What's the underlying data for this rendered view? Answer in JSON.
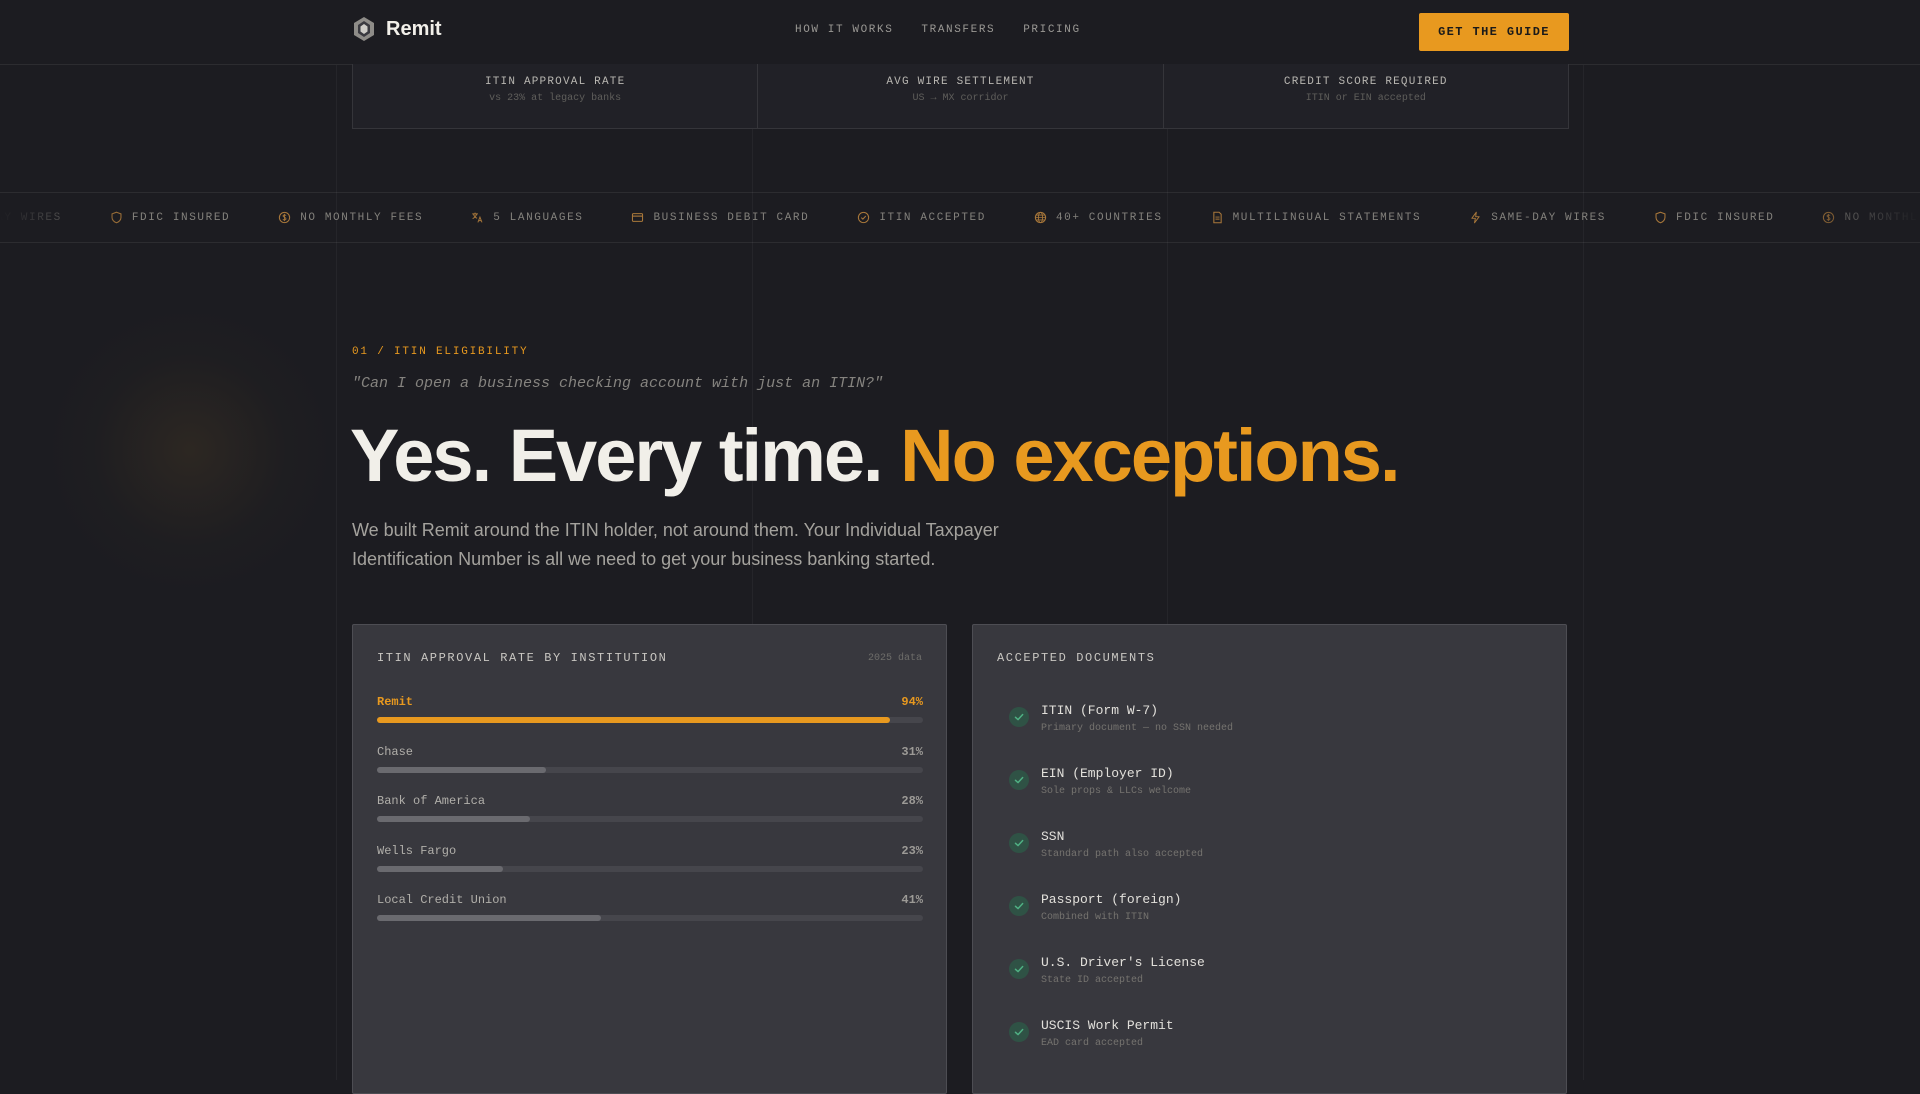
{
  "nav": {
    "brand": "Remit",
    "links": [
      "HOW IT WORKS",
      "TRANSFERS",
      "PRICING"
    ],
    "cta": "GET THE GUIDE"
  },
  "stats": [
    {
      "label": "ITIN APPROVAL RATE",
      "sub": "vs 23% at legacy banks"
    },
    {
      "label": "AVG WIRE SETTLEMENT",
      "sub": "US → MX corridor"
    },
    {
      "label": "CREDIT SCORE REQUIRED",
      "sub": "ITIN or EIN accepted"
    }
  ],
  "marquee": [
    {
      "label": "DAY WIRES",
      "icon": "bolt-icon"
    },
    {
      "label": "FDIC INSURED",
      "icon": "shield-icon"
    },
    {
      "label": "NO MONTHLY FEES",
      "icon": "dollar-circle-icon"
    },
    {
      "label": "5 LANGUAGES",
      "icon": "translate-icon"
    },
    {
      "label": "BUSINESS DEBIT CARD",
      "icon": "card-icon"
    },
    {
      "label": "ITIN ACCEPTED",
      "icon": "check-circle-icon"
    },
    {
      "label": "40+ COUNTRIES",
      "icon": "globe-icon"
    },
    {
      "label": "MULTILINGUAL STATEMENTS",
      "icon": "document-icon"
    },
    {
      "label": "SAME-DAY WIRES",
      "icon": "bolt-icon"
    },
    {
      "label": "FDIC INSURED",
      "icon": "shield-icon"
    },
    {
      "label": "NO MONTHL",
      "icon": "dollar-circle-icon"
    }
  ],
  "hero": {
    "eyebrow": "01 / ITIN ELIGIBILITY",
    "question": "\"Can I open a business checking account with just an ITIN?\"",
    "headline_plain": "Yes. Every time.",
    "headline_accent": "No exceptions.",
    "lead": "We built Remit around the ITIN holder, not around them. Your Individual Taxpayer Identification Number is all we need to get your business banking started."
  },
  "approval_card": {
    "title": "ITIN APPROVAL RATE BY INSTITUTION",
    "meta": "2025 data"
  },
  "chart_data": {
    "type": "bar",
    "orientation": "horizontal",
    "title": "ITIN APPROVAL RATE BY INSTITUTION",
    "categories": [
      "Remit",
      "Chase",
      "Bank of America",
      "Wells Fargo",
      "Local Credit Union"
    ],
    "values": [
      94,
      31,
      28,
      23,
      41
    ],
    "value_labels": [
      "94%",
      "31%",
      "28%",
      "23%",
      "41%"
    ],
    "unit": "%",
    "xlim": [
      0,
      100
    ],
    "highlight": "Remit",
    "highlight_color": "#e8991f",
    "bar_color": "#6a6a6f",
    "track_color": "#46464c",
    "grid": false
  },
  "documents_card": {
    "title": "ACCEPTED DOCUMENTS",
    "items": [
      {
        "name": "ITIN (Form W-7)",
        "note": "Primary document — no SSN needed"
      },
      {
        "name": "EIN (Employer ID)",
        "note": "Sole props & LLCs welcome"
      },
      {
        "name": "SSN",
        "note": "Standard path also accepted"
      },
      {
        "name": "Passport (foreign)",
        "note": "Combined with ITIN"
      },
      {
        "name": "U.S. Driver's License",
        "note": "State ID accepted"
      },
      {
        "name": "USCIS Work Permit",
        "note": "EAD card accepted"
      }
    ]
  },
  "colors": {
    "accent": "#e8991f",
    "background": "#1c1c21",
    "card": "#38383e",
    "check": "#2f5245"
  }
}
